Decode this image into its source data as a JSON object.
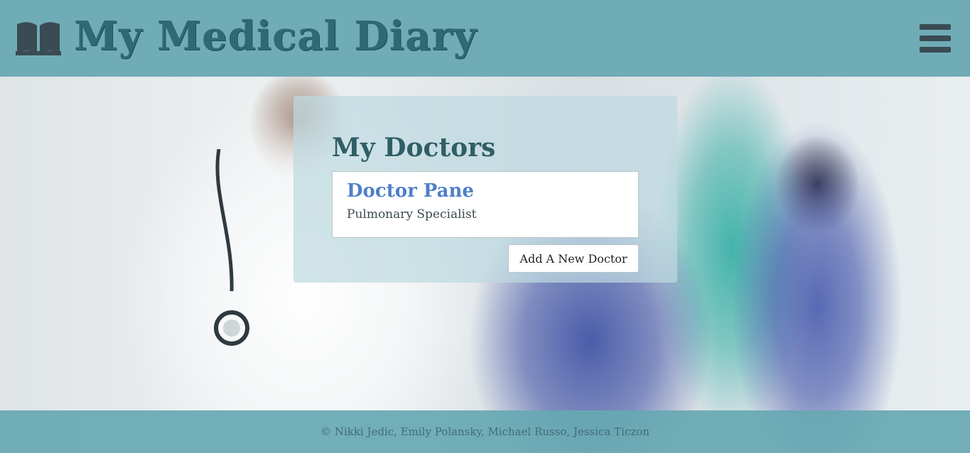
{
  "header": {
    "brand": "My Medical Diary",
    "logo_icon": "open-book-icon",
    "menu_icon": "hamburger-menu-icon"
  },
  "main": {
    "title": "My Doctors",
    "doctors": [
      {
        "name": "Doctor Pane",
        "specialty": "Pulmonary Specialist"
      }
    ],
    "add_button_label": "Add A New Doctor"
  },
  "footer": {
    "credits": "© Nikki Jedic, Emily Polansky, Michael Russo, Jessica Ticzon"
  },
  "colors": {
    "header_bg": "#70acb6",
    "brand_text": "#2f6a73",
    "panel_bg": "#bedae0",
    "doctor_link": "#4f7fc8"
  }
}
